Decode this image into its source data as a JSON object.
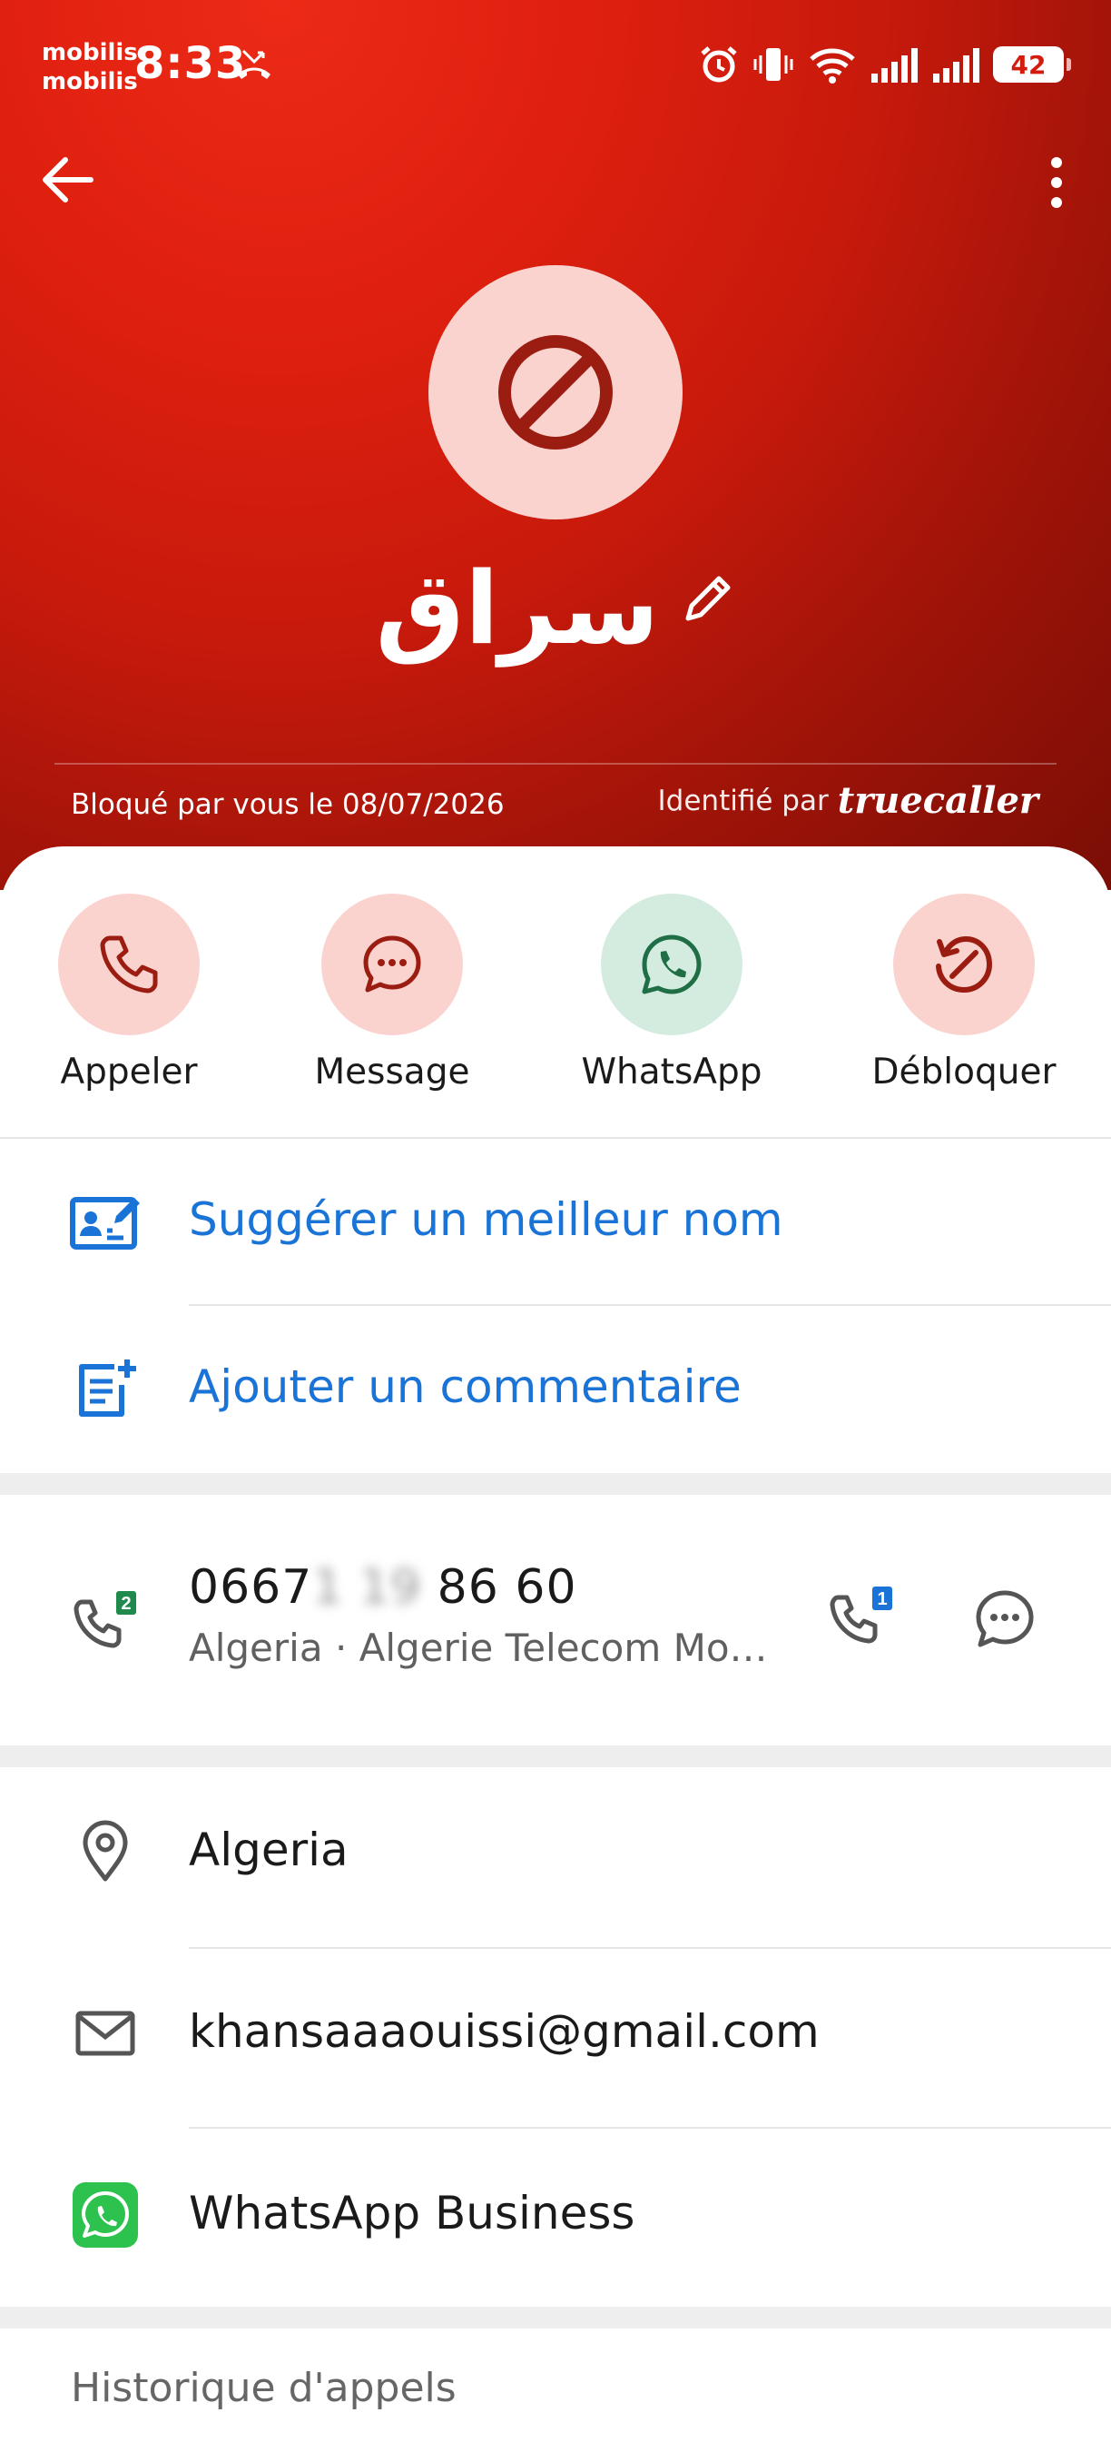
{
  "status_bar": {
    "carrier_line1": "mobilis",
    "carrier_line2": "mobilis",
    "time": "8:33",
    "battery": "42"
  },
  "contact": {
    "name": "سراق",
    "blocked_text": "Bloqué par vous le 08/07/2026",
    "identified_by": "Identifié par",
    "brand": "truecaller"
  },
  "actions": [
    {
      "label": "Appeler"
    },
    {
      "label": "Message"
    },
    {
      "label": "WhatsApp"
    },
    {
      "label": "Débloquer"
    }
  ],
  "options": {
    "suggest_name": "Suggérer un meilleur nom",
    "add_comment": "Ajouter un commentaire"
  },
  "phone": {
    "prefix": "0667",
    "hidden": "1 19",
    "suffix": "86 60",
    "country": "Algeria",
    "separator": "·",
    "operator": "Algerie Telecom Mo…",
    "sim_badge_left": "2",
    "sim_badge_right": "1"
  },
  "details": {
    "location": "Algeria",
    "email": "khansaaaouissi@gmail.com",
    "whatsapp_business": "WhatsApp Business"
  },
  "history": {
    "title": "Historique d'appels"
  },
  "colors": {
    "header_red": "#e0200f",
    "accent_blue": "#1a73d6",
    "block_dark_red": "#9b1c10",
    "whatsapp_green": "#1f8a4c"
  }
}
